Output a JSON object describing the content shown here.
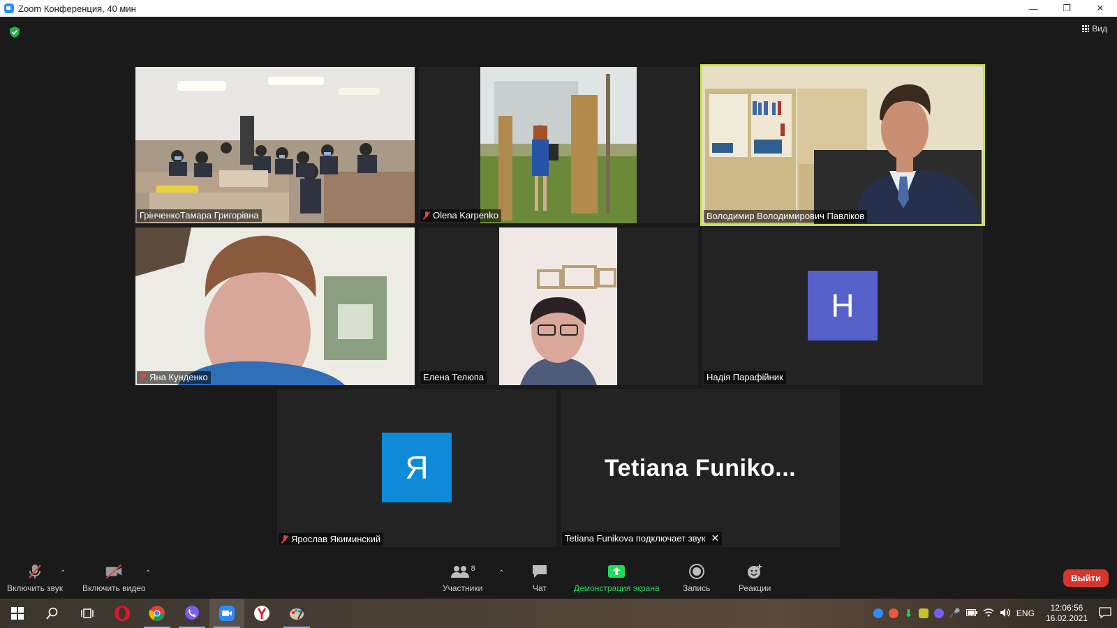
{
  "window": {
    "title": "Zoom Конференция, 40 мин"
  },
  "header": {
    "view_label": "Вид"
  },
  "participants": [
    {
      "name": "ГрінченкоТамара Григорівна",
      "muted": false
    },
    {
      "name": "Olena Karpenko",
      "muted": true
    },
    {
      "name": "Володимир Володимирович Павліков",
      "muted": false,
      "active": true
    },
    {
      "name": "Яна Кунденко",
      "muted": true
    },
    {
      "name": "Елена Телюпа",
      "muted": false
    },
    {
      "name": "Надія Парафійник",
      "muted": false,
      "avatar_letter": "Н",
      "avatar_color": "#5660c9"
    },
    {
      "name": "Ярослав Якиминский",
      "muted": true,
      "avatar_letter": "Я",
      "avatar_color": "#0e8ad8"
    },
    {
      "name": "Tetiana Funikova подключает звук",
      "big_name": "Tetiana  Funiko..."
    }
  ],
  "toolbar": {
    "unmute": "Включить звук",
    "start_video": "Включить видео",
    "participants": "Участники",
    "participants_count": "8",
    "chat": "Чат",
    "share_screen": "Демонстрация экрана",
    "record": "Запись",
    "reactions": "Реакции",
    "leave": "Выйти"
  },
  "taskbar": {
    "language": "ENG",
    "time": "12:06:56",
    "date": "16.02.2021"
  },
  "colors": {
    "share_green": "#23d959",
    "leave_red": "#d9342b",
    "active_speaker": "#c9e04a",
    "muted_red": "#e0463b"
  }
}
